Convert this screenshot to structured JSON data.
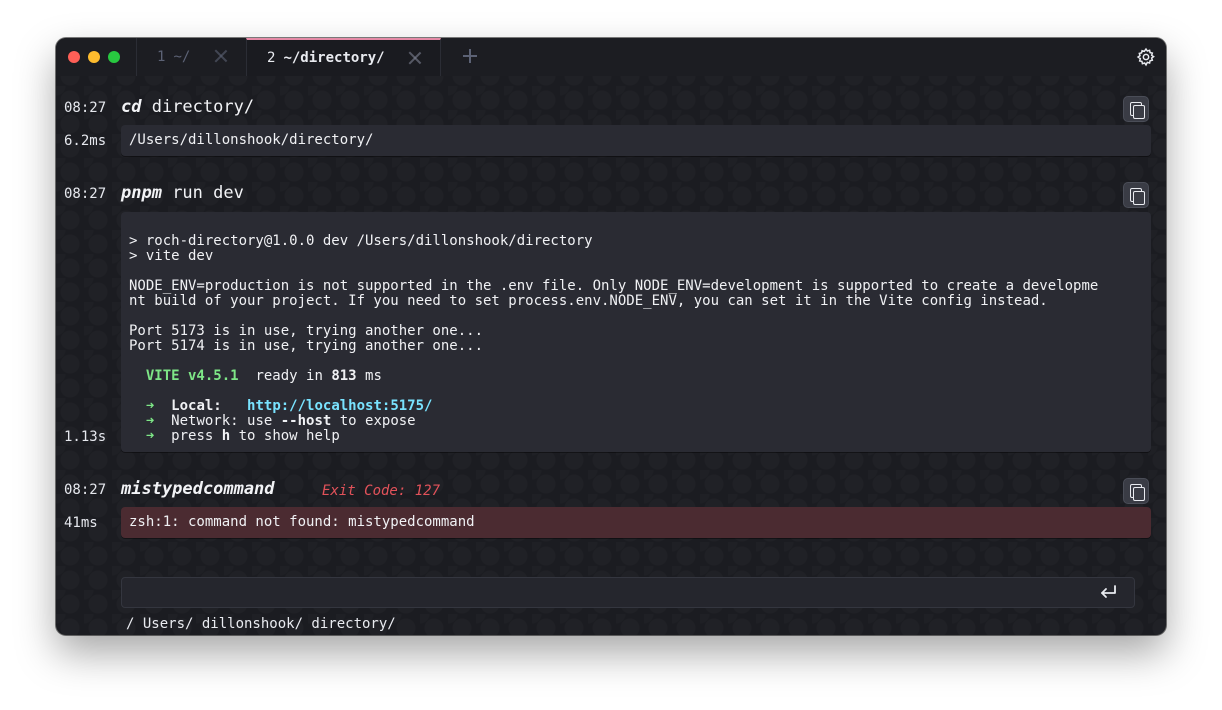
{
  "tabs": [
    {
      "num": "1",
      "label": "~/"
    },
    {
      "num": "2",
      "label": "~/directory/"
    }
  ],
  "blocks": [
    {
      "time": "08:27",
      "command": "cd",
      "args": " directory/",
      "duration": "6.2ms",
      "output": [
        "/Users/dillonshook/directory/"
      ]
    },
    {
      "time": "08:27",
      "command": "pnpm",
      "args": " run dev",
      "duration": "1.13s",
      "output": [
        "> roch-directory@1.0.0 dev /Users/dillonshook/directory",
        "> vite dev",
        "",
        "NODE_ENV=production is not supported in the .env file. Only NODE_ENV=development is supported to create a developme",
        "nt build of your project. If you need to set process.env.NODE_ENV, you can set it in the Vite config instead.",
        "",
        "Port 5173 is in use, trying another one...",
        "Port 5174 is in use, trying another one..."
      ],
      "vite_label": "VITE v4.5.1",
      "ready_text": "ready in",
      "ready_ms": "813",
      "ready_unit": "ms",
      "arrow": "➜",
      "local_label": "Local:",
      "local_url": "http://localhost:5175/",
      "network_prefix": "Network: use ",
      "network_flag": "--host",
      "network_suffix": " to expose",
      "help_prefix": "press ",
      "help_key": "h",
      "help_suffix": " to show help"
    },
    {
      "time": "08:27",
      "command": "mistypedcommand",
      "exit_code": "Exit Code: 127",
      "duration": "41ms",
      "output": [
        "zsh:1: command not found: mistypedcommand"
      ]
    }
  ],
  "input": {
    "value": ""
  },
  "cwd": "/ Users/ dillonshook/ directory/",
  "icons": [
    "close-icon",
    "plus-icon",
    "gear-icon",
    "copy-icon",
    "enter-icon"
  ],
  "colors": {
    "accent_tab": "#e58aa6",
    "error": "#e2525a",
    "url": "#79e3ff",
    "vite": "#7ee787"
  }
}
